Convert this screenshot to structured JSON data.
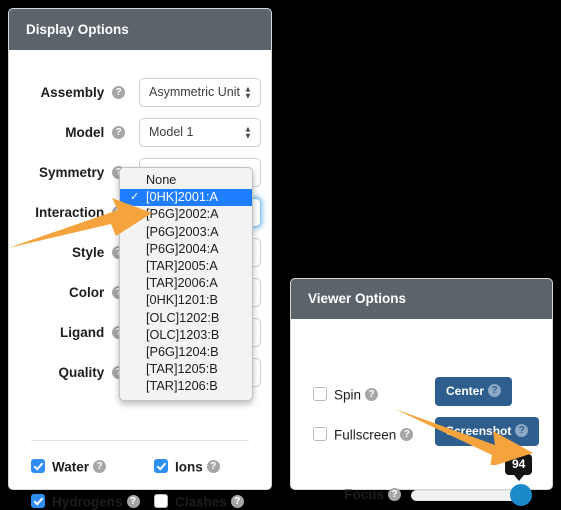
{
  "display_panel": {
    "title": "Display Options",
    "rows": [
      {
        "label": "Assembly",
        "value": "Asymmetric Unit"
      },
      {
        "label": "Model",
        "value": "Model 1"
      },
      {
        "label": "Symmetry",
        "value": "None"
      },
      {
        "label": "Interaction",
        "value": ""
      },
      {
        "label": "Style",
        "value": ""
      },
      {
        "label": "Color",
        "value": ""
      },
      {
        "label": "Ligand",
        "value": ""
      },
      {
        "label": "Quality",
        "value": ""
      }
    ],
    "dropdown": {
      "options": [
        "None",
        "[0HK]2001:A",
        "[P6G]2002:A",
        "[P6G]2003:A",
        "[P6G]2004:A",
        "[TAR]2005:A",
        "[TAR]2006:A",
        "[0HK]1201:B",
        "[OLC]1202:B",
        "[OLC]1203:B",
        "[P6G]1204:B",
        "[TAR]1205:B",
        "[TAR]1206:B"
      ],
      "selected_index": 1,
      "check_glyph": "✓"
    },
    "checkboxes": [
      {
        "label": "Water",
        "checked": true
      },
      {
        "label": "Ions",
        "checked": true
      },
      {
        "label": "Hydrogens",
        "checked": true
      },
      {
        "label": "Clashes",
        "checked": false
      }
    ]
  },
  "viewer_panel": {
    "title": "Viewer Options",
    "checkboxes": [
      {
        "label": "Spin",
        "checked": false
      },
      {
        "label": "Fullscreen",
        "checked": false
      }
    ],
    "buttons": [
      {
        "label": "Center"
      },
      {
        "label": "Screenshot"
      }
    ],
    "focus": {
      "label": "Focus",
      "value": "94"
    }
  },
  "icons": {
    "help": "?",
    "spinner_up": "▲",
    "spinner_down": "▼"
  },
  "colors": {
    "header_bg": "#5b636b",
    "accent_blue": "#2e5e8e",
    "selection_blue": "#1e7eff",
    "slider_blue": "#1c8ac9",
    "checkbox_blue": "#2f8ef4",
    "arrow_orange": "#f5a33c",
    "badge_black": "#131313",
    "page_bg": "#000000"
  }
}
